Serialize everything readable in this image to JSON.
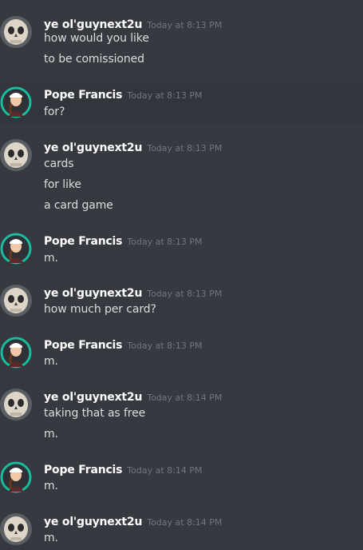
{
  "messages": [
    {
      "author": "ye ol'guynext2u",
      "timestamp": "Today at 8:13 PM",
      "lines": [
        "how would you like",
        "to be comissioned"
      ]
    },
    {
      "author": "Pope Francis",
      "timestamp": "Today at 8:13 PM",
      "lines": [
        "for?"
      ]
    },
    {
      "author": "ye ol'guynext2u",
      "timestamp": "Today at 8:13 PM",
      "lines": [
        "cards",
        "for like",
        "a card game"
      ]
    },
    {
      "author": "Pope Francis",
      "timestamp": "Today at 8:13 PM",
      "lines": [
        "m."
      ]
    },
    {
      "author": "ye ol'guynext2u",
      "timestamp": "Today at 8:13 PM",
      "lines": [
        "how much per card?"
      ]
    },
    {
      "author": "Pope Francis",
      "timestamp": "Today at 8:13 PM",
      "lines": [
        "m."
      ]
    },
    {
      "author": "ye ol'guynext2u",
      "timestamp": "Today at 8:14 PM",
      "lines": [
        "taking that as free",
        "m."
      ]
    },
    {
      "author": "Pope Francis",
      "timestamp": "Today at 8:14 PM",
      "lines": [
        "m."
      ]
    },
    {
      "author": "ye ol'guynext2u",
      "timestamp": "Today at 8:14 PM",
      "lines": [
        "m."
      ]
    }
  ],
  "colors": {
    "background": "#36393f",
    "username": "#ffffff",
    "timestamp": "#72767d",
    "message_text": "#dcddde",
    "accent_ring": "#1abc9c"
  },
  "icons": {
    "skull_avatar": "skull-avatar-icon",
    "pope_avatar": "pope-avatar-icon"
  }
}
